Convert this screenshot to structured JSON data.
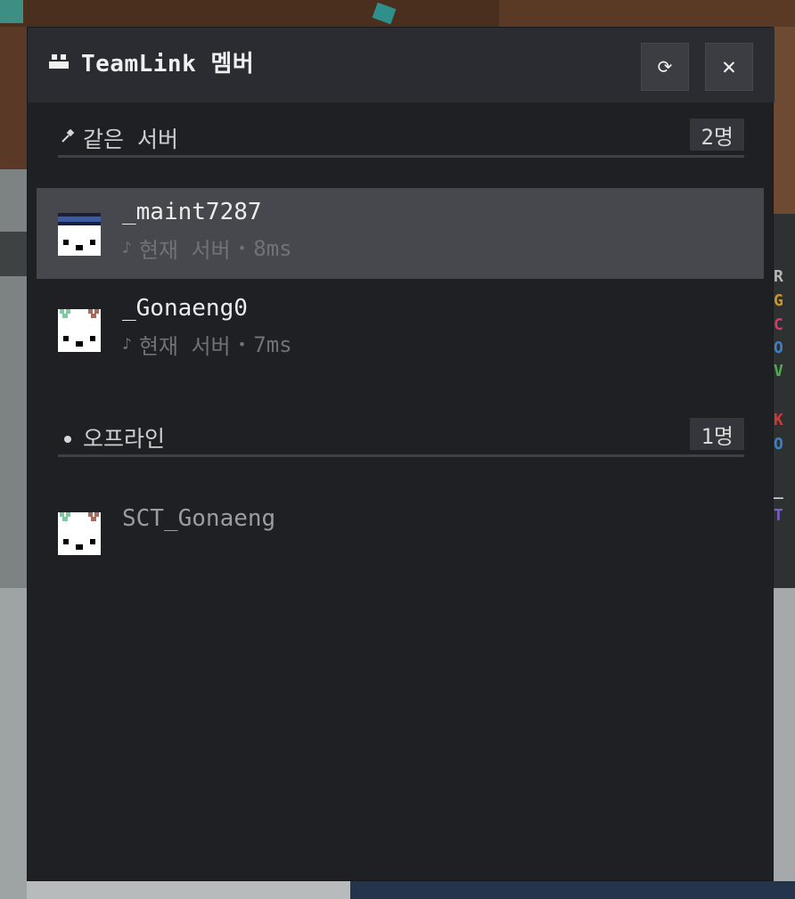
{
  "panel": {
    "title": "TeamLink 멤버",
    "title_icon": "people-icon",
    "refresh_glyph": "⟳",
    "close_glyph": "✕"
  },
  "sections": {
    "same_server": {
      "icon": "pin-icon",
      "glyph": "✎",
      "label": "같은 서버",
      "count": "2명"
    },
    "offline": {
      "icon": "dot-icon",
      "glyph": "●",
      "label": "오프라인",
      "count": "1명"
    }
  },
  "members": [
    {
      "name": "_maint7287",
      "status_glyph": "♪",
      "status": "현재 서버",
      "dot": "•",
      "ping": "8ms",
      "selected": true
    },
    {
      "name": "_Gonaeng0",
      "status_glyph": "♪",
      "status": "현재 서버",
      "dot": "•",
      "ping": "7ms",
      "selected": false
    }
  ],
  "offline_members": [
    {
      "name": "SCT_Gonaeng"
    }
  ],
  "colors": {
    "panel_bg": "#1f2024",
    "header_bg": "#2a2c31",
    "selected_row": "#46484d",
    "muted_text": "#6f7277"
  },
  "background_tab_letters": [
    "R",
    "G",
    "C",
    "O",
    "V",
    "K",
    "O",
    "_",
    "T"
  ],
  "background_tab_colors": [
    "#b7b7b7",
    "#c9962b",
    "#cf3b6a",
    "#3b7ec9",
    "#4fae4f",
    "#cf3b3b",
    "#3b7ec9",
    "#d0d0d0",
    "#7b5bc9"
  ]
}
